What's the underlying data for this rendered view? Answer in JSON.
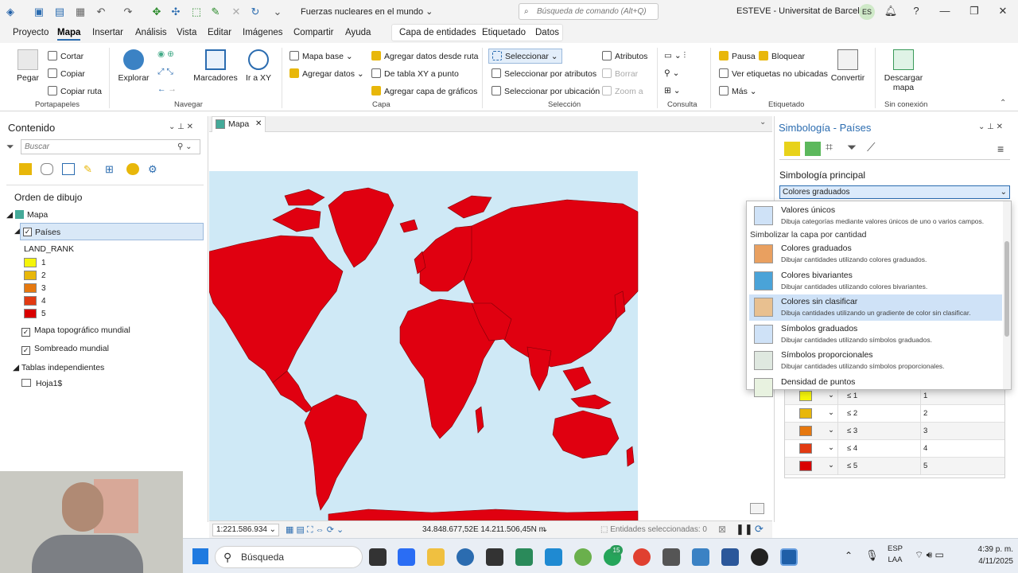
{
  "titlebar": {
    "doc_title": "Fuerzas nucleares en el mundo",
    "command_search_placeholder": "Búsqueda de comando (Alt+Q)",
    "user": "ESTEVE - Universitat de Barcelona",
    "user_initials": "ES",
    "help": "?"
  },
  "menu": {
    "items": [
      "Proyecto",
      "Mapa",
      "Insertar",
      "Análisis",
      "Vista",
      "Editar",
      "Imágenes",
      "Compartir",
      "Ayuda"
    ],
    "context_tabs": [
      "Capa de entidades",
      "Etiquetado",
      "Datos"
    ]
  },
  "ribbon": {
    "clipboard": {
      "label": "Portapapeles",
      "paste": "Pegar",
      "cut": "Cortar",
      "copy": "Copiar",
      "copy_path": "Copiar ruta"
    },
    "navigate": {
      "label": "Navegar",
      "explore": "Explorar",
      "bookmarks": "Marcadores",
      "go_to_xy": "Ir a XY"
    },
    "layer": {
      "label": "Capa",
      "basemap": "Mapa base",
      "add_data": "Agregar datos",
      "add_data_from_path": "Agregar datos desde ruta",
      "xy_table": "De tabla XY a punto",
      "add_graphics": "Agregar capa de gráficos"
    },
    "selection": {
      "label": "Selección",
      "select": "Seleccionar",
      "by_attributes": "Seleccionar por atributos",
      "by_location": "Seleccionar por ubicación",
      "attributes": "Atributos",
      "clear": "Borrar",
      "zoom_to": "Zoom a"
    },
    "inquiry": {
      "label": "Consulta"
    },
    "labeling": {
      "label": "Etiquetado",
      "pause": "Pausa",
      "lock": "Bloquear",
      "view_unplaced": "Ver etiquetas no ubicadas",
      "more": "Más",
      "convert": "Convertir"
    },
    "offline": {
      "label": "Sin conexión",
      "download_map": "Descargar mapa"
    }
  },
  "contents": {
    "title": "Contenido",
    "search_placeholder": "Buscar",
    "drawing_order": "Orden de dibujo",
    "map": "Mapa",
    "layer": "Países",
    "field": "LAND_RANK",
    "classes": [
      {
        "label": "1",
        "color": "#f5f50a"
      },
      {
        "label": "2",
        "color": "#e8b70a"
      },
      {
        "label": "3",
        "color": "#e6780f"
      },
      {
        "label": "4",
        "color": "#e23a12"
      },
      {
        "label": "5",
        "color": "#d90000"
      }
    ],
    "basemap1": "Mapa topográfico mundial",
    "basemap2": "Sombreado mundial",
    "standalone_tables": "Tablas independientes",
    "table": "Hoja1$"
  },
  "map": {
    "tab": "Mapa",
    "scale": "1:221.586.934",
    "coords": "34.848.677,52E 14.211.506,45N m",
    "selected": "Entidades seleccionadas: 0",
    "ocean_color": "#cfe9f6",
    "land_color": "#e00010"
  },
  "symbology": {
    "title": "Simbología - Países",
    "primary": "Simbología principal",
    "method": "Colores graduados",
    "dropdown": {
      "unique": {
        "title": "Valores únicos",
        "desc": "Dibuja categorías mediante valores únicos de uno o varios campos."
      },
      "section": "Simbolizar la capa por cantidad",
      "options": [
        {
          "title": "Colores graduados",
          "desc": "Dibujar cantidades utilizando colores graduados."
        },
        {
          "title": "Colores bivariantes",
          "desc": "Dibujar cantidades utilizando colores bivariantes."
        },
        {
          "title": "Colores sin clasificar",
          "desc": "Dibuja cantidades utilizando un gradiente de color sin clasificar."
        },
        {
          "title": "Símbolos graduados",
          "desc": "Dibujar cantidades utilizando símbolos graduados."
        },
        {
          "title": "Símbolos proporcionales",
          "desc": "Dibujar cantidades utilizando símbolos proporcionales."
        },
        {
          "title": "Densidad de puntos",
          "desc": ""
        }
      ]
    },
    "class_rows": [
      {
        "upper": "≤  1",
        "label": "1",
        "color": "#f5f50a"
      },
      {
        "upper": "≤  2",
        "label": "2",
        "color": "#e8b70a"
      },
      {
        "upper": "≤  3",
        "label": "3",
        "color": "#e6780f"
      },
      {
        "upper": "≤  4",
        "label": "4",
        "color": "#e23a12"
      },
      {
        "upper": "≤  5",
        "label": "5",
        "color": "#d90000"
      }
    ]
  },
  "taskbar": {
    "search": "Búsqueda",
    "badge_count": "15",
    "lang1": "ESP",
    "lang2": "LAA",
    "time": "4:39 p. m.",
    "date": "4/11/2025"
  }
}
